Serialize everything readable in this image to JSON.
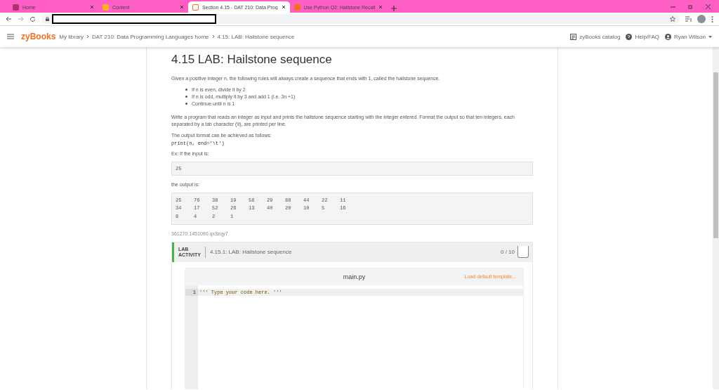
{
  "browser": {
    "tabs": [
      {
        "title": "Home",
        "selected": false
      },
      {
        "title": "Content",
        "selected": false
      },
      {
        "title": "Section 4.15 - DAT 210: Data Prog",
        "selected": true
      },
      {
        "title": "Use Python Q2: Hailstone Recall",
        "selected": false
      }
    ]
  },
  "header": {
    "logo": "zyBooks",
    "breadcrumb": [
      "My library",
      "DAT 210: Data Programming Languages home",
      "4.15: LAB: Hailstone sequence"
    ],
    "links": [
      "zyBooks catalog",
      "Help/FAQ",
      "Ryan Wilson"
    ]
  },
  "section": {
    "title": "4.15 LAB: Hailstone sequence",
    "intro": "Given a positive integer n, the following rules will always create a sequence that ends with 1, called the hailstone sequence.",
    "rules": [
      "If n is even, divide it by 2",
      "If n is odd, multiply it by 3 and add 1 (i.e. 3n +1)",
      "Continue until n is 1"
    ],
    "task": "Write a program that reads an integer as input and prints the hailstone sequence starting with the integer entered. Format the output so that ten integers, each separated by a tab character (\\t), are printed per line.",
    "format_note": "The output format can be achieved as follows:",
    "format_code": "print(n, end='\\t')",
    "input_label": "Ex: If the input is:",
    "input": "25",
    "output_label": "the output is:",
    "output": [
      [
        "25",
        "76",
        "38",
        "19",
        "58",
        "29",
        "88",
        "44",
        "22",
        "11"
      ],
      [
        "34",
        "17",
        "52",
        "26",
        "13",
        "40",
        "20",
        "10",
        "5",
        "16"
      ],
      [
        "8",
        "4",
        "2",
        "1"
      ]
    ],
    "id": "361270.1451090.qx3zqy7"
  },
  "lab": {
    "label": [
      "LAB",
      "ACTIVITY"
    ],
    "title": "4.15.1: LAB: Hailstone sequence",
    "score": "0 / 10",
    "file": "main.py",
    "load_link": "Load default template...",
    "lines": [
      {
        "number": "1",
        "code": "''' Type your code here. '''"
      }
    ]
  }
}
